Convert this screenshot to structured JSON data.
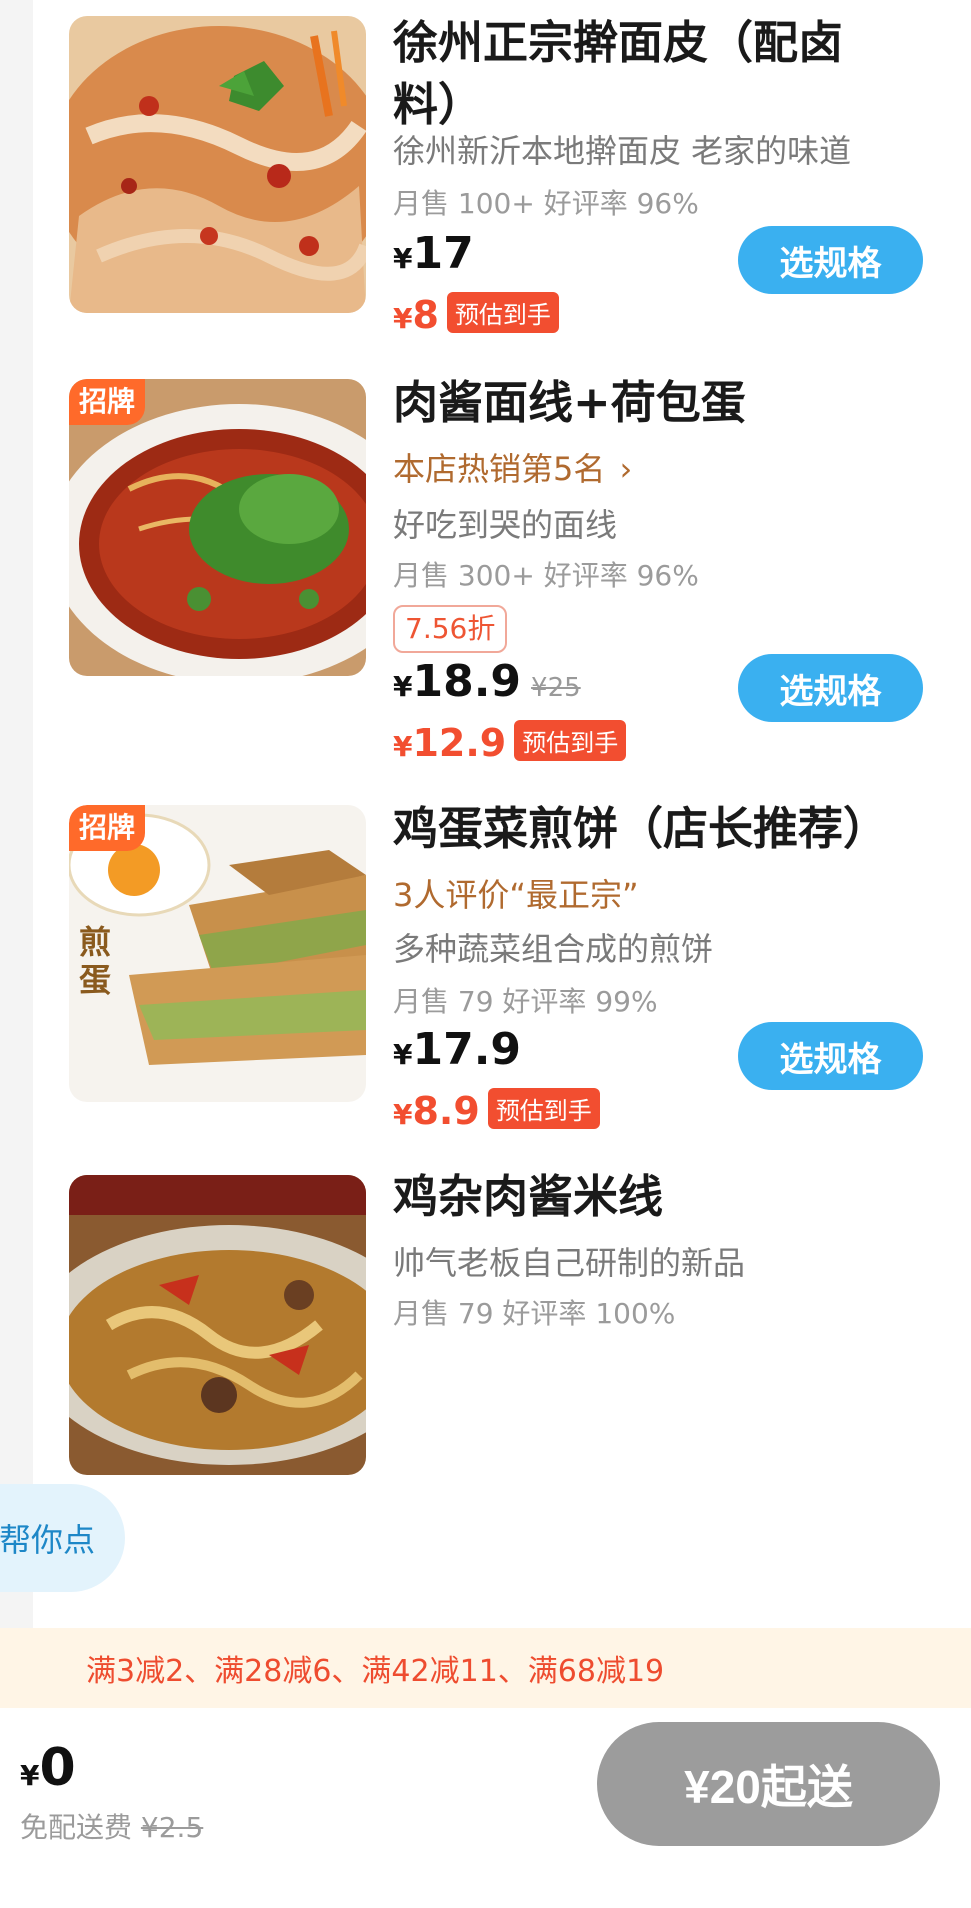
{
  "items": [
    {
      "title_line1": "徐州正宗擀面皮（配卤",
      "title_line2": "料）",
      "desc": "徐州新沂本地擀面皮 老家的味道",
      "sales": "月售 100+ 好评率 96%",
      "currency": "¥",
      "price": "17",
      "est_price": "8",
      "est_label": "预估到手",
      "button": "选规格"
    },
    {
      "badge": "招牌",
      "title": "肉酱面线+荷包蛋",
      "rank": "本店热销第5名",
      "desc": "好吃到哭的面线",
      "sales": "月售 300+ 好评率 96%",
      "discount": "7.56折",
      "currency": "¥",
      "price": "18.9",
      "orig_price": "¥25",
      "est_price": "12.9",
      "est_label": "预估到手",
      "button": "选规格"
    },
    {
      "badge": "招牌",
      "title": "鸡蛋菜煎饼（店长推荐）",
      "rank": "3人评价“最正宗”",
      "desc": "多种蔬菜组合成的煎饼",
      "sales": "月售 79 好评率 99%",
      "currency": "¥",
      "price": "17.9",
      "est_price": "8.9",
      "est_label": "预估到手",
      "button": "选规格",
      "image_text": "煎蛋"
    },
    {
      "title": "鸡杂肉酱米线",
      "desc": "帅气老板自己研制的新品",
      "sales": "月售 79 好评率 100%"
    }
  ],
  "float_bubble": "帮你点",
  "promo": "满3减2、满28减6、满42减11、满68减19",
  "cart": {
    "currency": "¥",
    "total": "0",
    "delivery_label": "免配送费",
    "delivery_orig": "¥2.5",
    "min_order": "¥20起送"
  }
}
